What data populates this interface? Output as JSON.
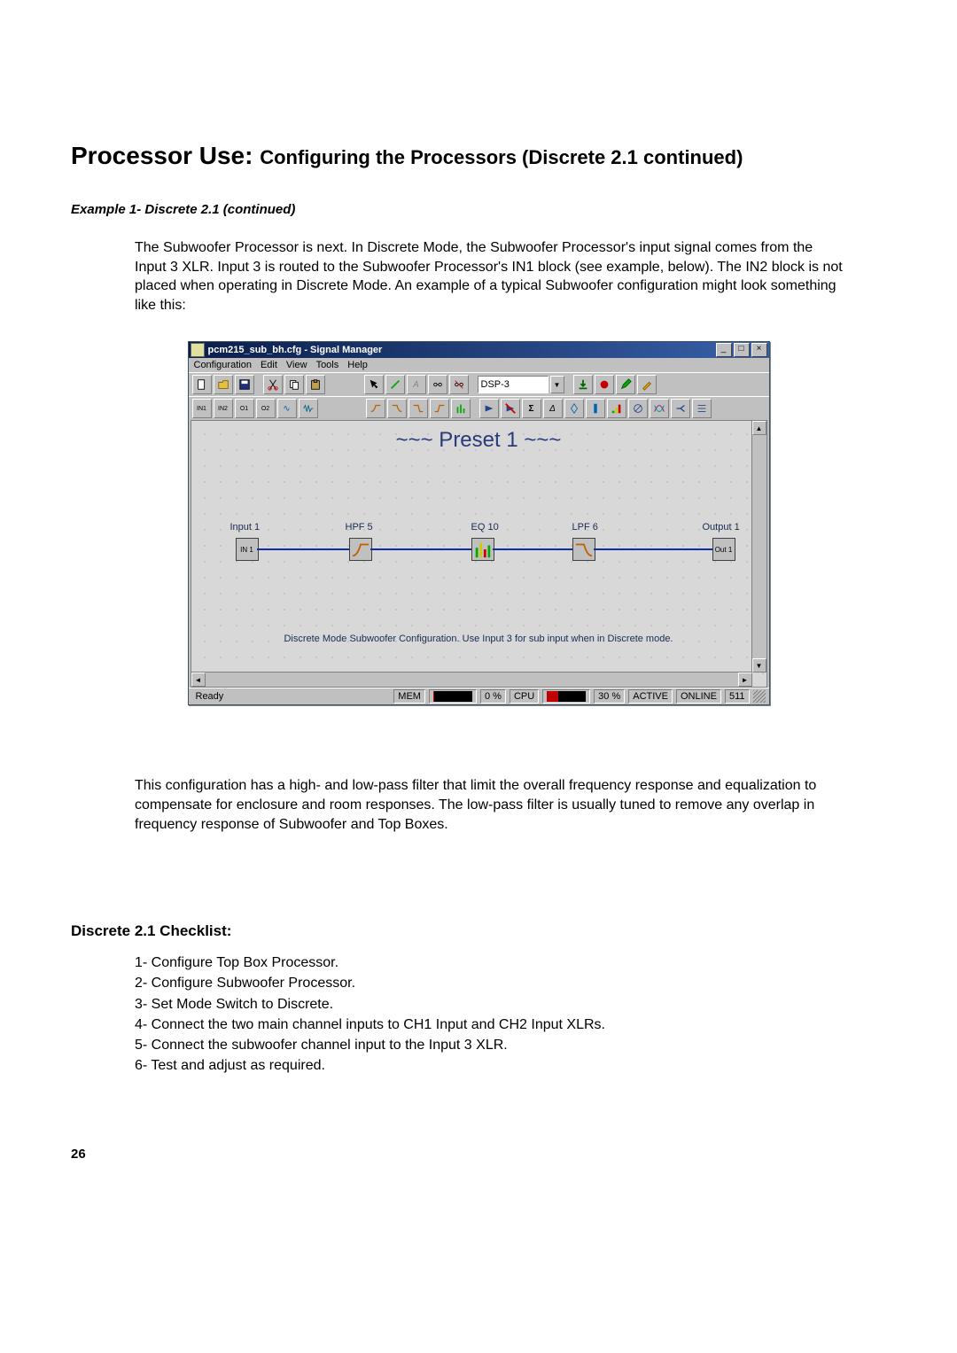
{
  "title_main": "Processor Use:",
  "title_sub": "Configuring the Processors (Discrete 2.1 continued)",
  "example_label": "Example 1- Discrete 2.1 (continued)",
  "para1": "The Subwoofer Processor is next. In Discrete Mode, the Subwoofer Processor's input signal comes from the Input 3 XLR. Input 3 is routed to the Subwoofer Processor's IN1 block (see example, below). The IN2 block is not placed when operating in Discrete Mode. An example of a typical Subwoofer configuration might look something like this:",
  "para2": "This configuration has a high- and low-pass filter that limit the overall frequency response and equalization to compensate for enclosure and room responses. The low-pass filter is usually tuned to remove any overlap in frequency response of Subwoofer and Top Boxes.",
  "checklist_title": "Discrete 2.1 Checklist:",
  "checklist": [
    "1- Configure Top Box Processor.",
    "2- Configure Subwoofer Processor.",
    "3- Set Mode Switch to Discrete.",
    "4- Connect the two main channel inputs to CH1 Input and CH2 Input XLRs.",
    "5- Connect the subwoofer channel input to the Input 3 XLR.",
    "6- Test and adjust as required."
  ],
  "page_number": "26",
  "signal_manager": {
    "window_title": "pcm215_sub_bh.cfg - Signal Manager",
    "menus": [
      "Configuration",
      "Edit",
      "View",
      "Tools",
      "Help"
    ],
    "dsp_value": "DSP-3",
    "preset_label": "~~~ Preset 1 ~~~",
    "nodes": {
      "input": {
        "label": "Input 1",
        "block": "IN 1"
      },
      "hpf": {
        "label": "HPF 5"
      },
      "eq": {
        "label": "EQ 10"
      },
      "lpf": {
        "label": "LPF 6"
      },
      "output": {
        "label": "Output 1",
        "block": "Out 1"
      }
    },
    "caption": "Discrete Mode Subwoofer Configuration. Use Input 3 for sub input when in Discrete mode.",
    "status": {
      "ready": "Ready",
      "mem_label": "MEM",
      "mem_pct": "0 %",
      "cpu_label": "CPU",
      "cpu_pct": "30 %",
      "active": "ACTIVE",
      "online": "ONLINE",
      "code": "511"
    }
  }
}
